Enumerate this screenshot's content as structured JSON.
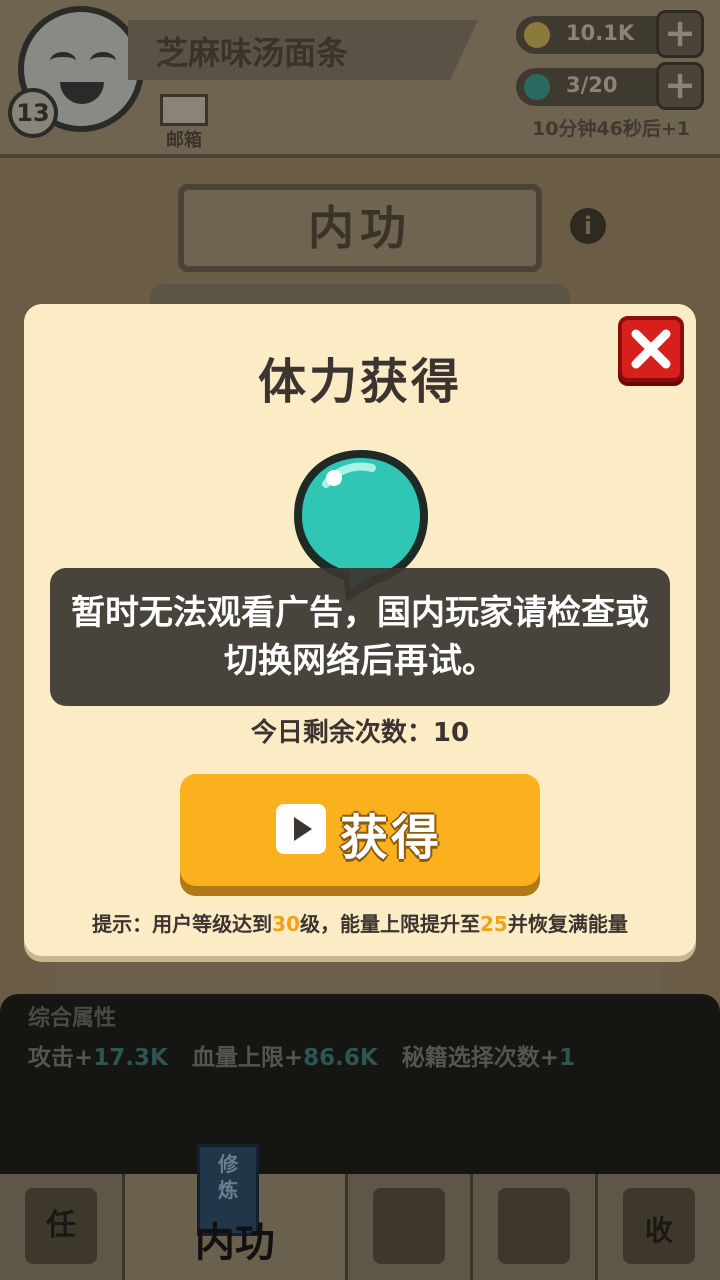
{
  "header": {
    "player_name": "芝麻味汤面条",
    "level": "13",
    "mail_label": "邮箱",
    "coins": "10.1K",
    "energy": "3/20",
    "recover_timer": "10分钟46秒后+1"
  },
  "page": {
    "title": "内功",
    "info_icon": "info-icon"
  },
  "stats": {
    "heading": "综合属性",
    "attack_label": "攻击+",
    "attack_value": "17.3K",
    "hp_label": "血量上限+",
    "hp_value": "86.6K",
    "secret_label": "秘籍选择次数+",
    "secret_value": "1"
  },
  "bottom_nav": {
    "tabs": [
      {
        "label": "任",
        "icon": "scroll-icon"
      },
      {
        "label": "内功",
        "book_label": "修炼",
        "icon": "book-icon"
      },
      {
        "label": "",
        "icon": "crossed-swords-icon"
      },
      {
        "label": "",
        "icon": "helmet-icon"
      },
      {
        "label": "收",
        "icon": "shop-icon"
      }
    ]
  },
  "dialog": {
    "title": "体力获得",
    "remaining_label": "今日剩余次数：",
    "remaining_count": "10",
    "get_button_label": "获得",
    "hint_prefix": "提示：用户等级达到",
    "hint_level": "30",
    "hint_mid": "级，能量上限提升至",
    "hint_cap": "25",
    "hint_suffix": "并恢复满能量"
  },
  "toast": {
    "message": "暂时无法观看广告，国内玩家请检查或切换网络后再试。"
  },
  "colors": {
    "dialog_bg": "#fcecc5",
    "button_yellow": "#fbb01d",
    "close_red": "#d7201c",
    "orb_teal": "#2fc6b4",
    "highlight_orange": "#f0a21a"
  }
}
